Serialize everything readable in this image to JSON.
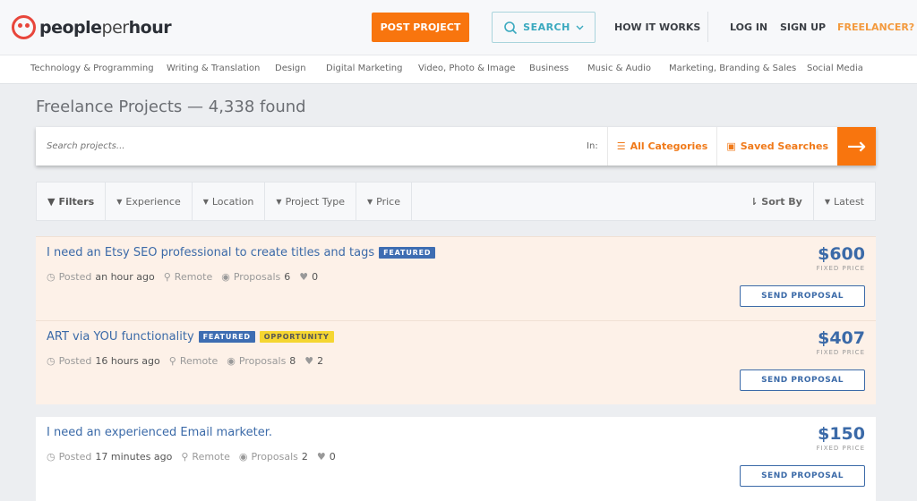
{
  "header": {
    "brand": "peopleperhour",
    "brand_parts": [
      "people",
      "per",
      "hour"
    ],
    "post_project": "POST PROJECT",
    "search": "SEARCH",
    "how_it_works": "HOW IT WORKS",
    "log_in": "LOG IN",
    "sign_up": "SIGN UP",
    "freelancer": "FREELANCER?"
  },
  "categories": [
    "Technology & Programming",
    "Writing & Translation",
    "Design",
    "Digital Marketing",
    "Video, Photo & Image",
    "Business",
    "Music & Audio",
    "Marketing, Branding & Sales",
    "Social Media"
  ],
  "page_title": "Freelance Projects — 4,338 found",
  "search": {
    "placeholder": "Search projects...",
    "in_label": "In:",
    "all_categories": "All Categories",
    "saved_searches": "Saved Searches"
  },
  "filters": {
    "filters": "Filters",
    "experience": "Experience",
    "location": "Location",
    "project_type": "Project Type",
    "price": "Price",
    "sort_by": "Sort By",
    "sort_value": "Latest"
  },
  "projects": [
    {
      "title": "I need an Etsy SEO professional to create titles and tags",
      "badges": [
        "FEATURED"
      ],
      "posted_label": "Posted",
      "posted": "an hour ago",
      "location": "Remote",
      "proposals_label": "Proposals",
      "proposals": "6",
      "likes": "0",
      "price": "$600",
      "price_type": "FIXED PRICE",
      "action": "SEND PROPOSAL"
    },
    {
      "title": "ART via YOU functionality",
      "badges": [
        "FEATURED",
        "OPPORTUNITY"
      ],
      "posted_label": "Posted",
      "posted": "16 hours ago",
      "location": "Remote",
      "proposals_label": "Proposals",
      "proposals": "8",
      "likes": "2",
      "price": "$407",
      "price_type": "FIXED PRICE",
      "action": "SEND PROPOSAL"
    },
    {
      "title": "I need an experienced Email marketer.",
      "badges": [],
      "posted_label": "Posted",
      "posted": "17 minutes ago",
      "location": "Remote",
      "proposals_label": "Proposals",
      "proposals": "2",
      "likes": "0",
      "price": "$150",
      "price_type": "FIXED PRICE",
      "action": "SEND PROPOSAL"
    }
  ],
  "colors": {
    "accent": "#f8750e",
    "link": "#3b6aa8",
    "featured_bg": "#fdf1e8"
  }
}
